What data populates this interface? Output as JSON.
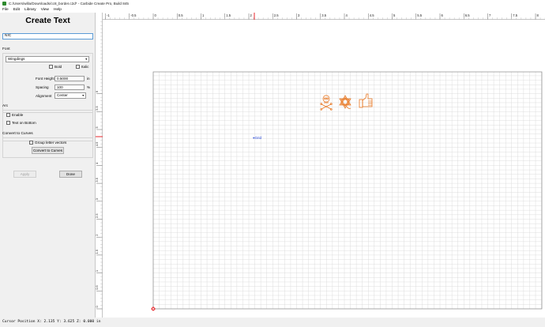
{
  "window": {
    "title": "C:/Users/willa/Downloads/cc8_border.c2d* - Carbide Create Pro, Build 845"
  },
  "menu": [
    "File",
    "Edit",
    "Library",
    "View",
    "Help"
  ],
  "panel": {
    "title": "Create Text",
    "text_value": "N!C",
    "font_section": "Font",
    "font_name": "Wingdings",
    "bold_label": "Bold",
    "italic_label": "Italic",
    "font_height_label": "Font Height",
    "font_height_value": "0.5000",
    "font_height_unit": "in",
    "spacing_label": "Spacing",
    "spacing_value": "100",
    "spacing_unit": "%",
    "alignment_label": "Alignment",
    "alignment_value": "Center",
    "arc_section": "Arc",
    "enable_label": "Enable",
    "text_on_bottom_label": "Text on Bottom",
    "convert_section": "Convert to Curves",
    "group_vectors_label": "Group letter vectors",
    "convert_button": "Convert to Curves",
    "apply_button": "Apply",
    "done_button": "Done"
  },
  "canvas": {
    "grid_label": "Grid",
    "top_ruler": [
      "-1",
      "-0.5",
      "0",
      "0.5",
      "1",
      "1.5",
      "2",
      "2.5",
      "3",
      "3.5",
      "4",
      "4.5",
      "5",
      "5.5",
      "6",
      "6.5",
      "7",
      "7.5",
      "8"
    ],
    "left_ruler": [
      "6",
      "5.5",
      "5",
      "4.5",
      "4",
      "3.5",
      "3",
      "2.5",
      "2",
      "1.5",
      "1",
      "0.5",
      "0"
    ],
    "accent_color": "#e87722"
  },
  "status": {
    "cursor_position": "Cursor Position X: 2.135 Y: 3.625 Z: 0.000 in"
  }
}
